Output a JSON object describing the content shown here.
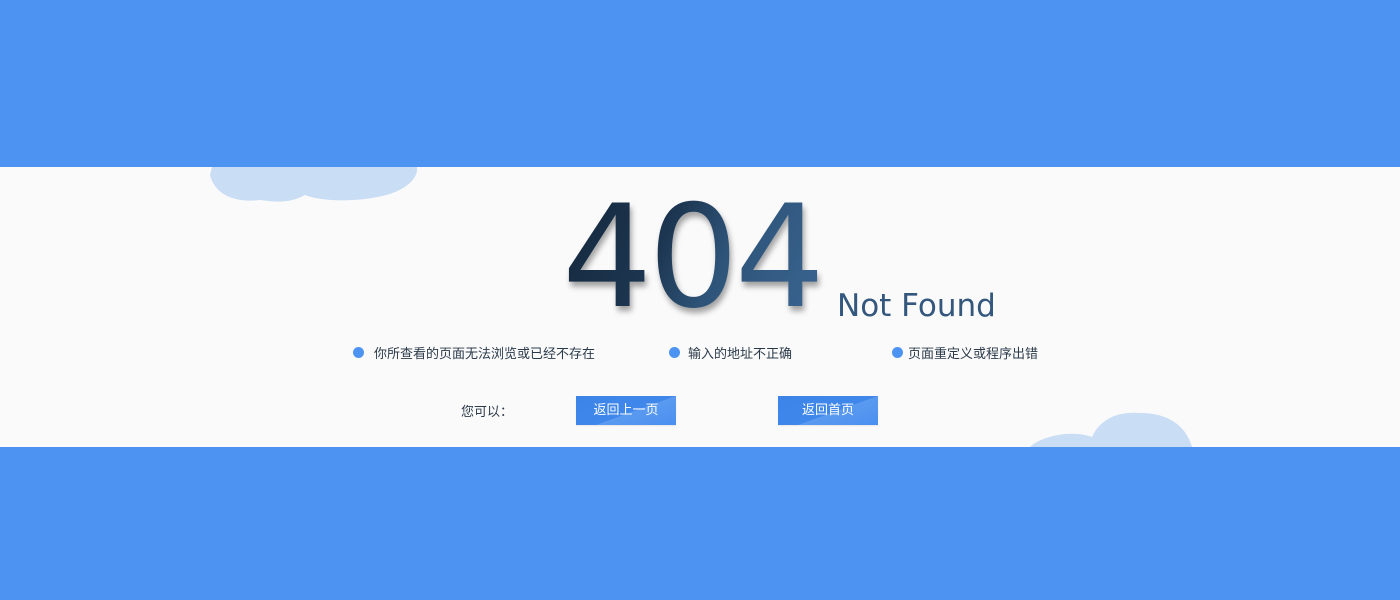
{
  "error": {
    "code": "404",
    "title": "Not Found"
  },
  "reasons": [
    "你所查看的页面无法浏览或已经不存在",
    "输入的地址不正确",
    "页面重定义或程序出错"
  ],
  "actions": {
    "prompt": "您可以：",
    "back_label": "返回上一页",
    "home_label": "返回首页"
  },
  "colors": {
    "accent": "#4d94f2",
    "content_bg": "#fafafa",
    "heading": "#1f3a55",
    "subtitle": "#34577d",
    "cloud": "#c9ddf5"
  }
}
